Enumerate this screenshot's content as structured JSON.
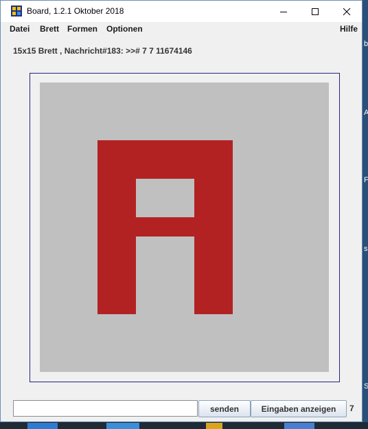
{
  "window": {
    "title": "Board, 1.2.1 Oktober 2018"
  },
  "menu": {
    "items": [
      "Datei",
      "Brett",
      "Formen",
      "Optionen"
    ],
    "help": "Hilfe"
  },
  "status": {
    "text": "15x15 Brett , Nachricht#183: >># 7 7 11674146"
  },
  "board": {
    "size": 15,
    "background_color": "#c0c0c0",
    "fill_color": "#b22222",
    "frame_color": "#22227a",
    "shape": "letter A"
  },
  "input": {
    "value": "",
    "placeholder": ""
  },
  "buttons": {
    "send_label": "senden",
    "show_inputs_label": "Eingaben anzeigen"
  },
  "count": "7",
  "desktop": {
    "strip_marks": [
      "b",
      "A",
      "Fo",
      "sl",
      "Si"
    ]
  }
}
